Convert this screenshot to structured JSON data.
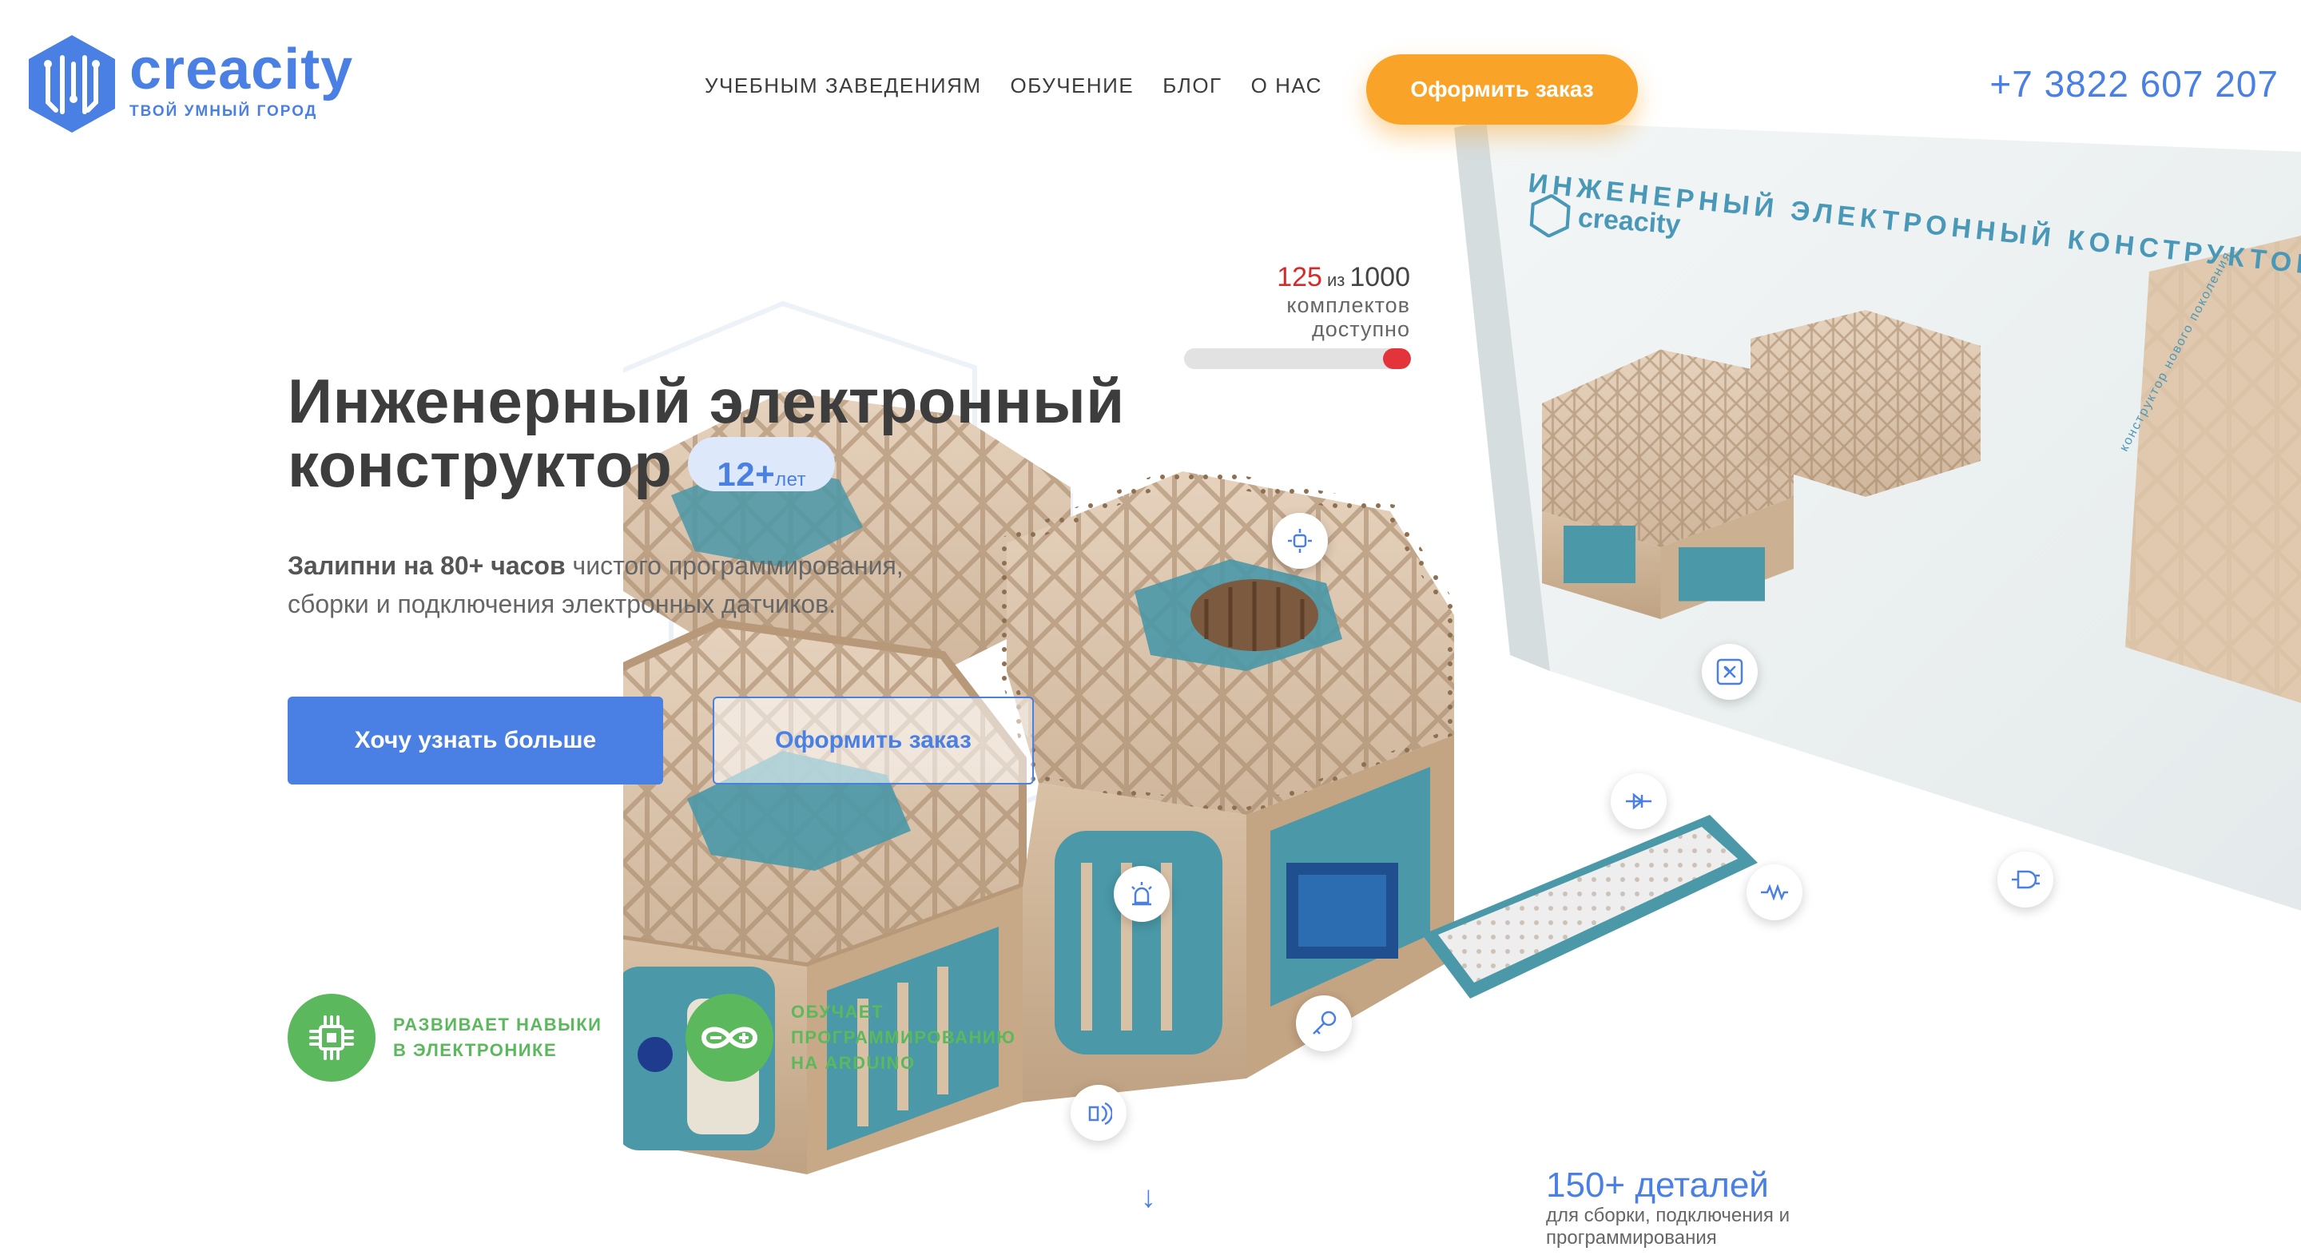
{
  "brand": {
    "name": "creacity",
    "tagline": "твой умный город",
    "accent": "#4a7fe3",
    "orange": "#f9a429",
    "green": "#5cb85c"
  },
  "nav": {
    "items": [
      {
        "label": "Учебным заведениям"
      },
      {
        "label": "Обучение"
      },
      {
        "label": "Блог"
      },
      {
        "label": "О нас"
      }
    ]
  },
  "header": {
    "cta_label": "Оформить заказ",
    "phone": "+7 3822 607 207"
  },
  "box": {
    "title": "ИНЖЕНЕРНЫЙ ЭЛЕКТРОННЫЙ КОНСТРУКТОР",
    "brand": "creacity",
    "side_text": "конструктор нового поколения"
  },
  "counter": {
    "current": "125",
    "of": "из",
    "total": "1000",
    "caption_line1": "комплектов",
    "caption_line2": "доступно",
    "fraction_available": 0.125
  },
  "hero": {
    "title_line1": "Инженерный электронный",
    "title_line2": "конструктор",
    "age_num": "12+",
    "age_unit": "лет",
    "desc_bold": "Залипни на 80+ часов",
    "desc_rest1": " чистого программирования,",
    "desc_line2": "сборки и подключения электронных датчиков.",
    "primary_btn": "Хочу узнать больше",
    "secondary_btn": "Оформить заказ"
  },
  "features": [
    {
      "line1": "Развивает навыки",
      "line2": "в электронике",
      "icon": "chip-icon"
    },
    {
      "line1": "Обучает",
      "line2": "программированию",
      "line3": "на Arduino",
      "icon": "arduino-icon"
    }
  ],
  "parts": {
    "title": "150+ деталей",
    "subtitle": "для сборки, подключения и программирования"
  },
  "scroll": {
    "arrow": "↓"
  },
  "hotspots": [
    {
      "name": "light-sensor-hotspot",
      "icon": "led-icon"
    },
    {
      "name": "fan-hotspot",
      "icon": "fan-icon"
    },
    {
      "name": "diode-hotspot",
      "icon": "diode-icon"
    },
    {
      "name": "alarm-hotspot",
      "icon": "siren-icon"
    },
    {
      "name": "resistor-hotspot",
      "icon": "resistor-icon"
    },
    {
      "name": "plug-hotspot",
      "icon": "plug-icon"
    },
    {
      "name": "key-hotspot",
      "icon": "key-icon"
    },
    {
      "name": "sound-hotspot",
      "icon": "speaker-icon"
    }
  ]
}
